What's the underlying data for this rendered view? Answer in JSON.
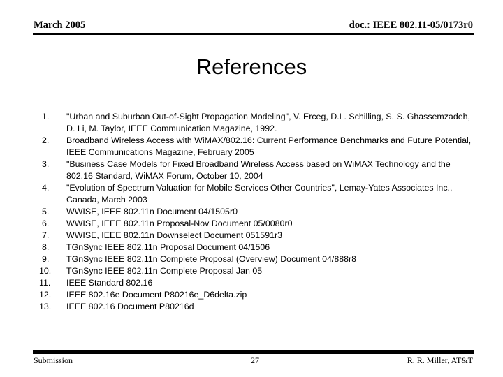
{
  "header": {
    "left": "March 2005",
    "right": "doc.: IEEE 802.11-05/0173r0"
  },
  "title": "References",
  "references": [
    {
      "num": "1.",
      "text": "\"Urban and Suburban Out-of-Sight Propagation Modeling\", V. Erceg, D.L. Schilling, S. S. Ghassemzadeh, D. Li, M. Taylor, IEEE Communication Magazine, 1992."
    },
    {
      "num": "2.",
      "text": "Broadband Wireless Access with WiMAX/802.16: Current Performance Benchmarks and Future Potential, IEEE Communications Magazine, February 2005"
    },
    {
      "num": "3.",
      "text": "\"Business Case Models for Fixed Broadband Wireless Access based on WiMAX Technology and the 802.16 Standard, WiMAX Forum, October 10, 2004"
    },
    {
      "num": "4.",
      "text": "\"Evolution of Spectrum Valuation for Mobile Services Other Countries\", Lemay-Yates Associates Inc., Canada, March 2003"
    },
    {
      "num": "5.",
      "text": "WWISE, IEEE 802.11n Document 04/1505r0"
    },
    {
      "num": "6.",
      "text": "WWISE, IEEE 802.11n Proposal-Nov Document 05/0080r0"
    },
    {
      "num": "7.",
      "text": "WWISE,  IEEE 802.11n Downselect Document 051591r3"
    },
    {
      "num": "8.",
      "text": "TGnSync IEEE 802.11n Proposal Document 04/1506"
    },
    {
      "num": "9.",
      "text": "TGnSync IEEE 802.11n Complete Proposal (Overview) Document 04/888r8"
    },
    {
      "num": "10.",
      "text": "TGnSync IEEE 802.11n Complete Proposal Jan 05"
    },
    {
      "num": "11.",
      "text": "IEEE Standard 802.16"
    },
    {
      "num": "12.",
      "text": "IEEE 802.16e Document P80216e_D6delta.zip"
    },
    {
      "num": "13.",
      "text": "IEEE 802.16 Document P80216d"
    }
  ],
  "footer": {
    "left": "Submission",
    "page": "27",
    "right": "R. R. Miller, AT&T"
  }
}
